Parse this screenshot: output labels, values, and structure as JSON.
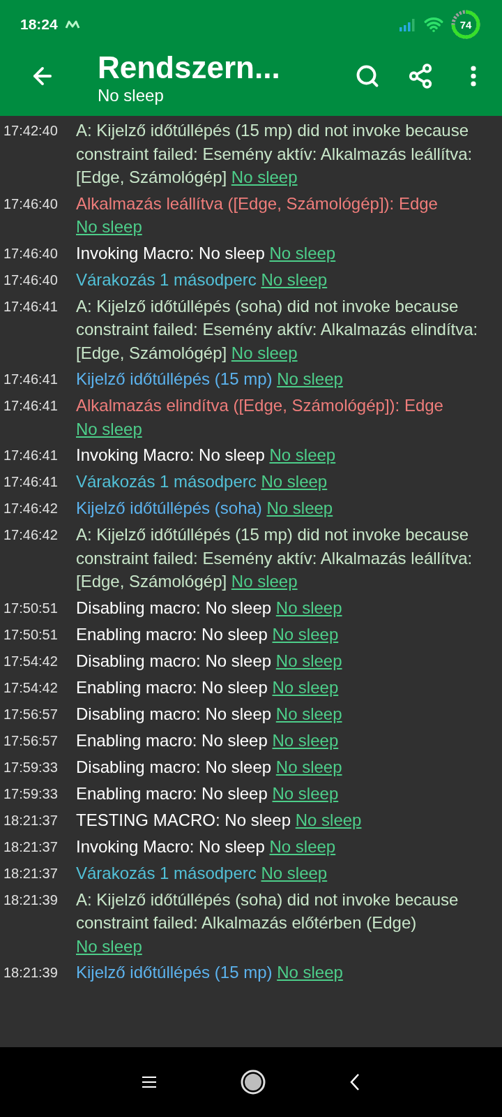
{
  "status_bar": {
    "time": "18:24",
    "battery": "74"
  },
  "toolbar": {
    "title": "Rendszern...",
    "subtitle": "No sleep"
  },
  "log": [
    {
      "time": "17:42:40",
      "kind": "constraint",
      "text": "A: Kijelző időtúllépés (15 mp) did not invoke because constraint failed: Esemény aktív: Alkalmazás leállítva: [Edge, Számológép]",
      "link": "No sleep"
    },
    {
      "time": "17:46:40",
      "kind": "trigger",
      "text": "Alkalmazás leállítva ([Edge, Számológép]): Edge",
      "link": "No sleep"
    },
    {
      "time": "17:46:40",
      "kind": "info",
      "text": "Invoking Macro: No sleep",
      "link": "No sleep"
    },
    {
      "time": "17:46:40",
      "kind": "wait",
      "text": "Várakozás 1 másodperc",
      "link": "No sleep"
    },
    {
      "time": "17:46:41",
      "kind": "constraint",
      "text": "A: Kijelző időtúllépés (soha) did not invoke because constraint failed: Esemény aktív: Alkalmazás elindítva: [Edge, Számológép]",
      "link": "No sleep"
    },
    {
      "time": "17:46:41",
      "kind": "action",
      "text": "Kijelző időtúllépés (15 mp)",
      "link": "No sleep"
    },
    {
      "time": "17:46:41",
      "kind": "trigger",
      "text": "Alkalmazás elindítva ([Edge, Számológép]): Edge",
      "link": "No sleep"
    },
    {
      "time": "17:46:41",
      "kind": "info",
      "text": "Invoking Macro: No sleep",
      "link": "No sleep"
    },
    {
      "time": "17:46:41",
      "kind": "wait",
      "text": "Várakozás 1 másodperc",
      "link": "No sleep"
    },
    {
      "time": "17:46:42",
      "kind": "action",
      "text": "Kijelző időtúllépés (soha)",
      "link": "No sleep"
    },
    {
      "time": "17:46:42",
      "kind": "constraint",
      "text": "A: Kijelző időtúllépés (15 mp) did not invoke because constraint failed: Esemény aktív: Alkalmazás leállítva: [Edge, Számológép]",
      "link": "No sleep"
    },
    {
      "time": "17:50:51",
      "kind": "info",
      "text": "Disabling macro: No sleep",
      "link": "No sleep"
    },
    {
      "time": "17:50:51",
      "kind": "info",
      "text": "Enabling macro: No sleep",
      "link": "No sleep"
    },
    {
      "time": "17:54:42",
      "kind": "info",
      "text": "Disabling macro: No sleep",
      "link": "No sleep"
    },
    {
      "time": "17:54:42",
      "kind": "info",
      "text": "Enabling macro: No sleep",
      "link": "No sleep"
    },
    {
      "time": "17:56:57",
      "kind": "info",
      "text": "Disabling macro: No sleep",
      "link": "No sleep"
    },
    {
      "time": "17:56:57",
      "kind": "info",
      "text": "Enabling macro: No sleep",
      "link": "No sleep"
    },
    {
      "time": "17:59:33",
      "kind": "info",
      "text": "Disabling macro: No sleep",
      "link": "No sleep"
    },
    {
      "time": "17:59:33",
      "kind": "info",
      "text": "Enabling macro: No sleep",
      "link": "No sleep"
    },
    {
      "time": "18:21:37",
      "kind": "info",
      "text": "TESTING MACRO: No sleep",
      "link": "No sleep"
    },
    {
      "time": "18:21:37",
      "kind": "info",
      "text": "Invoking Macro: No sleep",
      "link": "No sleep"
    },
    {
      "time": "18:21:37",
      "kind": "wait",
      "text": "Várakozás 1 másodperc",
      "link": "No sleep"
    },
    {
      "time": "18:21:39",
      "kind": "constraint",
      "text": "A: Kijelző időtúllépés (soha) did not invoke because constraint failed: Alkalmazás előtérben (Edge)",
      "link": "No sleep"
    },
    {
      "time": "18:21:39",
      "kind": "action",
      "text": "Kijelző időtúllépés (15 mp)",
      "link": "No sleep"
    }
  ]
}
